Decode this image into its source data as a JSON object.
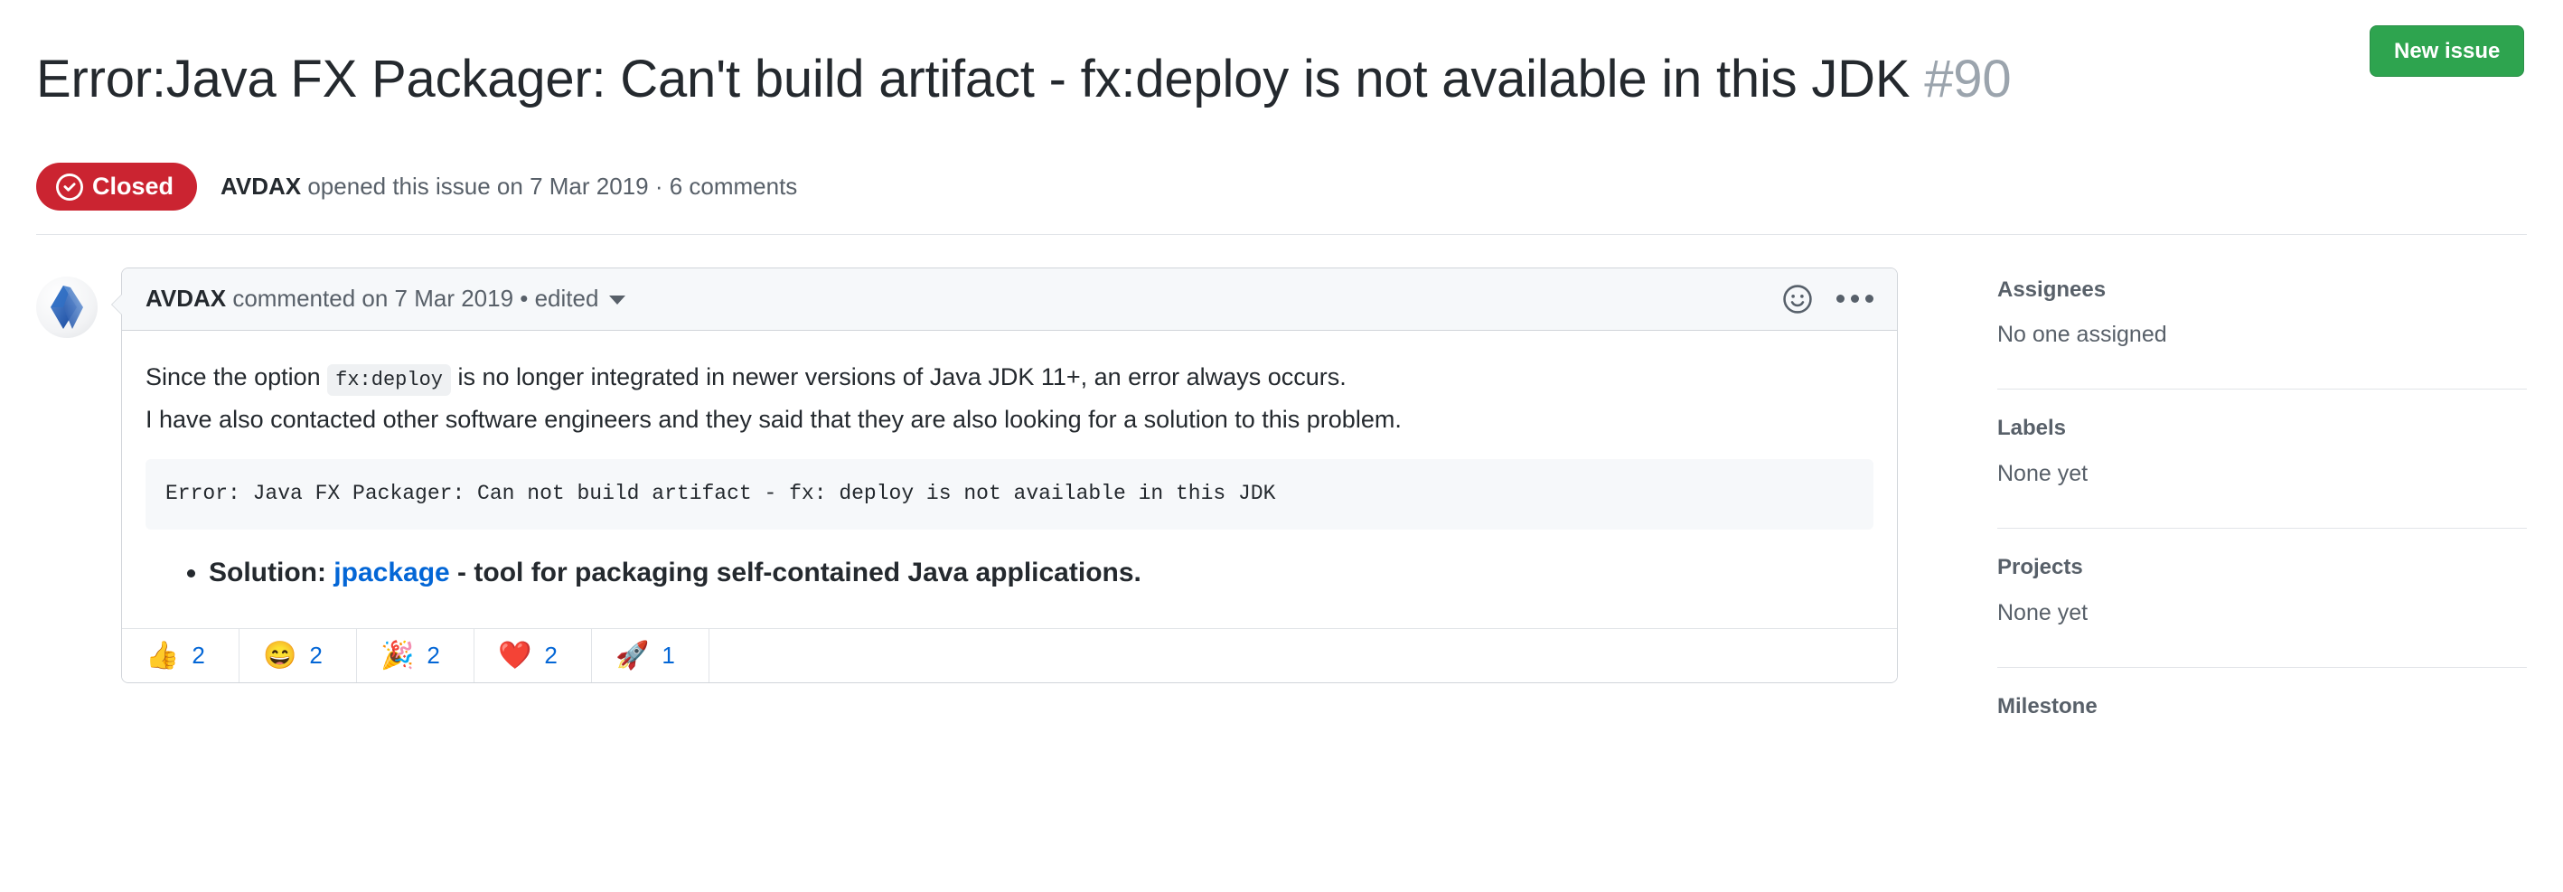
{
  "header": {
    "title": "Error:Java FX Packager: Can't build artifact - fx:deploy is not available in this JDK",
    "issue_number": "#90",
    "new_issue_label": "New issue",
    "state_badge": {
      "label": "Closed",
      "icon": "issue-closed-icon",
      "color": "#cb2431"
    },
    "meta": {
      "author": "AVDAX",
      "rest": " opened this issue on 7 Mar 2019 · 6 comments"
    }
  },
  "comment": {
    "avatar_icon": "user-avatar",
    "author": "AVDAX",
    "header_rest": " commented on 7 Mar 2019 • edited",
    "actions": {
      "add_reaction_icon": "smiley-icon",
      "more_options_icon": "kebab-menu-icon"
    },
    "body": {
      "paragraph_1_before": "Since the option ",
      "inline_code": "fx:deploy",
      "paragraph_1_after": " is no longer integrated in newer versions of Java JDK 11+, an error always occurs.",
      "paragraph_2": "I have also contacted other software engineers and they said that they are also looking for a solution to this problem.",
      "code_block": "Error: Java FX Packager: Can not build artifact - fx: deploy is not available in this JDK",
      "list_item_prefix": "Solution: ",
      "list_item_link": "jpackage",
      "list_item_suffix": " - tool for packaging self-contained Java applications."
    },
    "reactions": [
      {
        "name": "thumbs-up",
        "emoji": "👍",
        "count": "2"
      },
      {
        "name": "laugh",
        "emoji": "😄",
        "count": "2"
      },
      {
        "name": "hooray",
        "emoji": "🎉",
        "count": "2"
      },
      {
        "name": "heart",
        "emoji": "❤️",
        "count": "2"
      },
      {
        "name": "rocket",
        "emoji": "🚀",
        "count": "1"
      }
    ]
  },
  "sidebar": {
    "sections": [
      {
        "title": "Assignees",
        "value": "No one assigned"
      },
      {
        "title": "Labels",
        "value": "None yet"
      },
      {
        "title": "Projects",
        "value": "None yet"
      },
      {
        "title": "Milestone",
        "value": ""
      }
    ]
  },
  "colors": {
    "accent_link": "#0366d6",
    "closed_red": "#cb2431",
    "button_green": "#2ea44f"
  }
}
